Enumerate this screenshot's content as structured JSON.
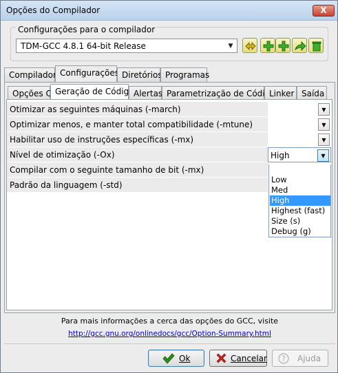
{
  "window": {
    "title": "Opções do Compilador",
    "close_glyph": "X"
  },
  "compiler_group": {
    "label": "Configurações para o compilador",
    "selected_compiler": "TDM-GCC 4.8.1 64-bit Release",
    "toolbar_icons": [
      "rename-set-icon",
      "add-set-icon",
      "add-set-folder-icon",
      "export-set-icon",
      "delete-set-icon"
    ]
  },
  "main_tabs": [
    "Compilador",
    "Configurações",
    "Diretórios",
    "Programas"
  ],
  "main_tabs_active": "Configurações",
  "sub_tabs": [
    "Opções C",
    "Geração de Código",
    "Alertas",
    "Parametrização de Código",
    "Linker",
    "Saída"
  ],
  "sub_tabs_active": "Geração de Código",
  "options": [
    {
      "label": "Otimizar as seguintes máquinas (-march)",
      "value": ""
    },
    {
      "label": "Optimizar menos, e manter total compatibilidade (-mtune)",
      "value": ""
    },
    {
      "label": "Habilitar uso de instruções específicas (-mx)",
      "value": ""
    },
    {
      "label": "Nível de otimização (-Ox)",
      "value": "High"
    },
    {
      "label": "Compilar com o seguinte tamanho de bit (-mx)",
      "value": ""
    },
    {
      "label": "Padrão da linguagem (-std)",
      "value": ""
    }
  ],
  "dropdown_options": [
    "",
    "Low",
    "Med",
    "High",
    "Highest (fast)",
    "Size (s)",
    "Debug (g)"
  ],
  "dropdown_selected": "High",
  "footer": {
    "info_text": "Para mais informações a cerca das opções do GCC, visite",
    "link": "http://gcc.gnu.org/onlinedocs/gcc/Option-Summary.html"
  },
  "buttons": {
    "ok": "Ok",
    "cancel": "Cancelar",
    "help": "Ajuda"
  },
  "colors": {
    "selection": "#3399ff",
    "link": "#0000cc",
    "ok_check": "#2e8b1e",
    "cancel_x": "#c0251b"
  }
}
